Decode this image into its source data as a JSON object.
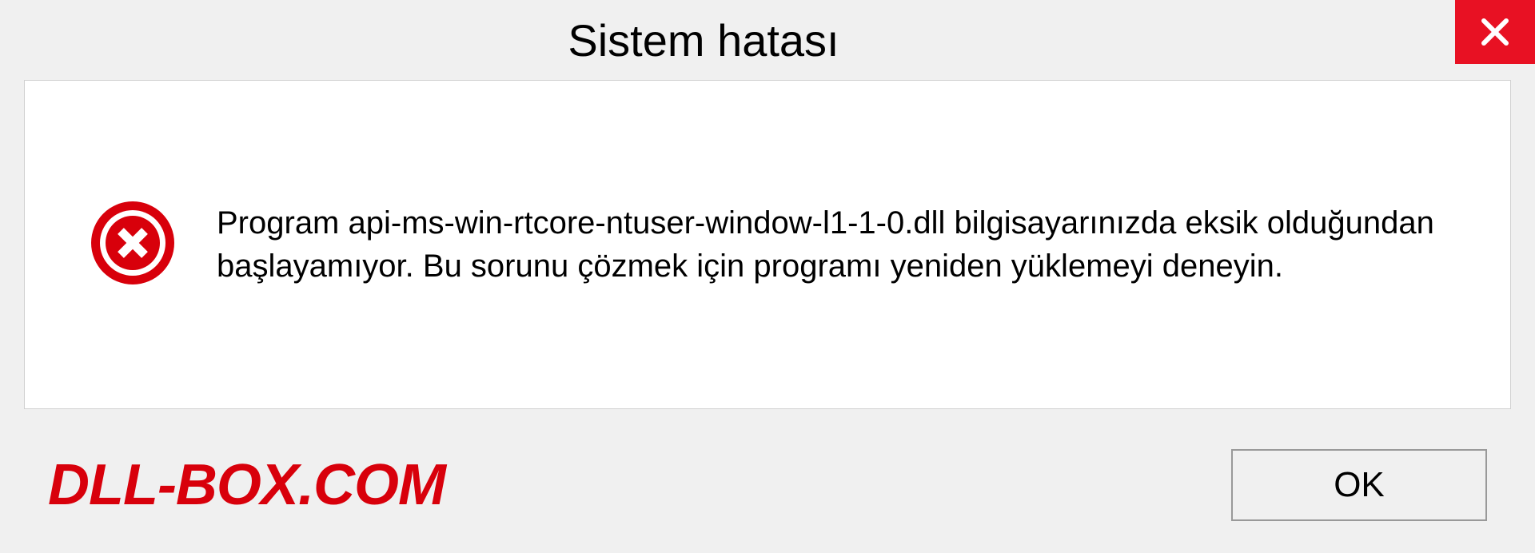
{
  "dialog": {
    "title": "Sistem hatası",
    "message": "Program api-ms-win-rtcore-ntuser-window-l1-1-0.dll bilgisayarınızda eksik olduğundan başlayamıyor. Bu sorunu çözmek için programı yeniden yüklemeyi deneyin.",
    "ok_label": "OK"
  },
  "watermark": "DLL-BOX.COM",
  "colors": {
    "close_button": "#e81123",
    "watermark": "#d8000b",
    "error_icon": "#d8000b"
  }
}
